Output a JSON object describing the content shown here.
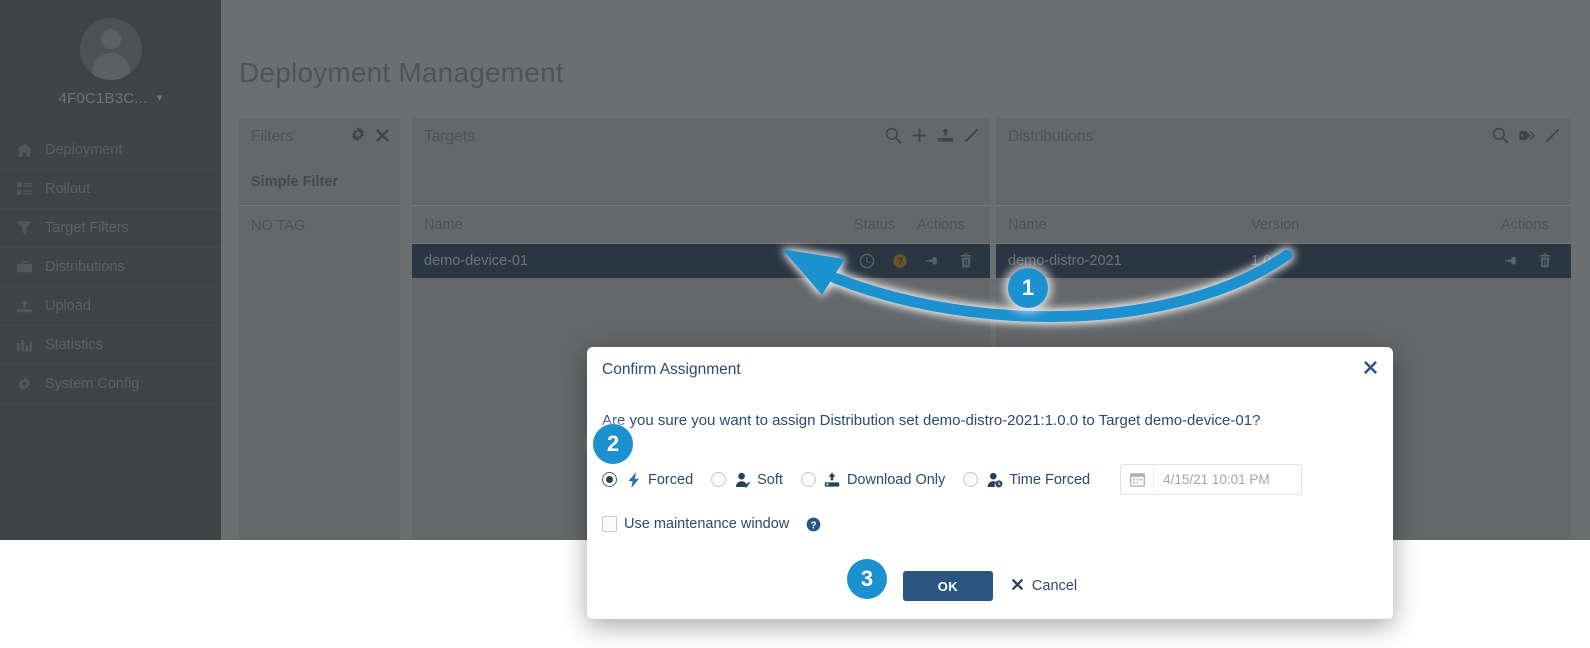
{
  "sidebar": {
    "user": {
      "name": "4F0C1B3C...",
      "chevron": "chevron-down-icon"
    },
    "items": [
      {
        "label": "Deployment",
        "icon": "home-icon",
        "active": true
      },
      {
        "label": "Rollout",
        "icon": "list-icon",
        "active": false
      },
      {
        "label": "Target Filters",
        "icon": "funnel-icon",
        "active": false
      },
      {
        "label": "Distributions",
        "icon": "briefcase-icon",
        "active": false
      },
      {
        "label": "Upload",
        "icon": "upload-icon",
        "active": false
      },
      {
        "label": "Statistics",
        "icon": "bar-chart-icon",
        "active": false
      },
      {
        "label": "System Config",
        "icon": "gear-icon",
        "active": false
      }
    ]
  },
  "page": {
    "title": "Deployment Management"
  },
  "filters_panel": {
    "title": "Filters",
    "tools": [
      "gear-icon",
      "close-icon"
    ],
    "section_label": "Simple Filter",
    "items": [
      "NO TAG"
    ]
  },
  "targets_panel": {
    "title": "Targets",
    "tools": [
      "search-icon",
      "plus-icon",
      "distribute-icon",
      "maximize-icon"
    ],
    "columns": [
      "Name",
      "Status",
      "Actions"
    ],
    "rows": [
      {
        "name": "demo-device-01",
        "status": "",
        "actions": [
          "clock-icon",
          "question-circle-icon",
          "pin-icon",
          "trash-icon"
        ]
      }
    ]
  },
  "distributions_panel": {
    "title": "Distributions",
    "tools": [
      "search-icon",
      "tag-icon",
      "maximize-icon"
    ],
    "columns": [
      "Name",
      "Version",
      "Actions"
    ],
    "rows": [
      {
        "name": "demo-distro-2021",
        "version": "1.0.0",
        "actions": [
          "pin-icon",
          "trash-icon"
        ]
      }
    ]
  },
  "annotations": {
    "badge_1": "1",
    "badge_2": "2",
    "badge_3": "3",
    "arrow_color": "#1b91d0"
  },
  "dialog": {
    "title": "Confirm Assignment",
    "close_icon": "close-icon",
    "message": "Are you sure you want to assign Distribution set demo-distro-2021:1.0.0 to Target demo-device-01?",
    "action_options": [
      {
        "label": "Forced",
        "icon": "bolt-icon",
        "selected": true
      },
      {
        "label": "Soft",
        "icon": "user-check-icon",
        "selected": false
      },
      {
        "label": "Download Only",
        "icon": "download-tray-icon",
        "selected": false
      },
      {
        "label": "Time Forced",
        "icon": "user-clock-icon",
        "selected": false
      }
    ],
    "date_field": {
      "icon": "calendar-icon",
      "value": "4/15/21 10:01 PM"
    },
    "maintenance": {
      "label": "Use maintenance window",
      "checked": false,
      "help_icon": "question-circle-icon"
    },
    "ok_label": "OK",
    "cancel_label": "Cancel",
    "cancel_icon": "close-icon"
  },
  "colors": {
    "accent_blue": "#1b91d0",
    "dialog_text": "#2b4a6b",
    "ok_button": "#2a5580",
    "sidebar_bg": "#3e4446",
    "content_bg": "#6c6f70",
    "panel_bg": "#646869",
    "selected_row": "#2a3642"
  }
}
